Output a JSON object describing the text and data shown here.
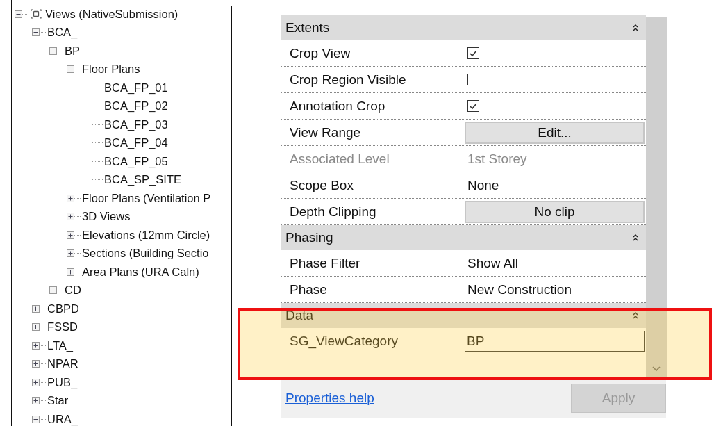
{
  "browser": {
    "root": {
      "label": "Views (NativeSubmission)",
      "expanded": true,
      "children": [
        {
          "label": "BCA_",
          "expanded": true,
          "children": [
            {
              "label": "BP",
              "expanded": true,
              "children": [
                {
                  "label": "Floor Plans",
                  "expanded": true,
                  "children": [
                    {
                      "label": "BCA_FP_01"
                    },
                    {
                      "label": "BCA_FP_02"
                    },
                    {
                      "label": "BCA_FP_03"
                    },
                    {
                      "label": "BCA_FP_04"
                    },
                    {
                      "label": "BCA_FP_05"
                    },
                    {
                      "label": "BCA_SP_SITE"
                    }
                  ]
                },
                {
                  "label": "Floor Plans (Ventilation P",
                  "expanded": false
                },
                {
                  "label": "3D Views",
                  "expanded": false
                },
                {
                  "label": "Elevations (12mm Circle)",
                  "expanded": false
                },
                {
                  "label": "Sections (Building Sectio",
                  "expanded": false
                },
                {
                  "label": "Area Plans (URA Caln)",
                  "expanded": false
                }
              ]
            },
            {
              "label": "CD",
              "expanded": false
            }
          ]
        },
        {
          "label": "CBPD",
          "expanded": false
        },
        {
          "label": "FSSD",
          "expanded": false
        },
        {
          "label": "LTA_",
          "expanded": false
        },
        {
          "label": "NPAR",
          "expanded": false
        },
        {
          "label": "PUB_",
          "expanded": false
        },
        {
          "label": "Star",
          "expanded": false
        },
        {
          "label": "URA_",
          "expanded": true
        }
      ]
    }
  },
  "properties": {
    "groups": [
      {
        "title": "Extents",
        "expanded": true,
        "rows": [
          {
            "kind": "checkbox",
            "label": "Crop View",
            "checked": true
          },
          {
            "kind": "checkbox",
            "label": "Crop Region Visible",
            "checked": false
          },
          {
            "kind": "checkbox",
            "label": "Annotation Crop",
            "checked": true
          },
          {
            "kind": "button",
            "label": "View Range",
            "value": "Edit..."
          },
          {
            "kind": "text",
            "label": "Associated Level",
            "value": "1st Storey",
            "disabled": true
          },
          {
            "kind": "text",
            "label": "Scope Box",
            "value": "None",
            "disabled": false
          },
          {
            "kind": "button",
            "label": "Depth Clipping",
            "value": "No clip"
          }
        ]
      },
      {
        "title": "Phasing",
        "expanded": true,
        "rows": [
          {
            "kind": "text",
            "label": "Phase Filter",
            "value": "Show All",
            "disabled": false
          },
          {
            "kind": "text",
            "label": "Phase",
            "value": "New Construction",
            "disabled": false
          }
        ]
      },
      {
        "title": "Data",
        "expanded": true,
        "rows": [
          {
            "kind": "field",
            "label": "SG_ViewCategory",
            "value": "BP"
          }
        ]
      }
    ],
    "help_link": "Properties help",
    "apply_button": {
      "label": "Apply",
      "disabled": true
    },
    "highlight": true
  }
}
